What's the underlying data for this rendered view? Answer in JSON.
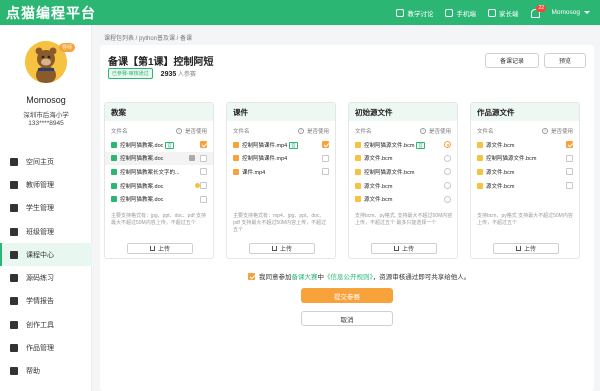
{
  "app": {
    "logo": "点猫编程平台"
  },
  "topnav": {
    "items": [
      {
        "label": "教学讨论",
        "icon": "discussion-icon"
      },
      {
        "label": "手机端",
        "icon": "mobile-icon"
      },
      {
        "label": "家长端",
        "icon": "parent-icon"
      }
    ],
    "notifications": "22",
    "username": "Momosog"
  },
  "profile": {
    "avatar_tag": "导师",
    "name": "Momosog",
    "school": "深圳市后海小学",
    "phone": "133****8945"
  },
  "sidebar": {
    "items": [
      {
        "label": "空间主页",
        "icon": "home-icon"
      },
      {
        "label": "教师管理",
        "icon": "teachers-icon"
      },
      {
        "label": "学生管理",
        "icon": "students-icon"
      },
      {
        "label": "班级管理",
        "icon": "class-icon"
      },
      {
        "label": "课程中心",
        "icon": "course-icon"
      },
      {
        "label": "源码练习",
        "icon": "code-icon"
      },
      {
        "label": "学情报告",
        "icon": "report-icon"
      },
      {
        "label": "创作工具",
        "icon": "tools-icon"
      },
      {
        "label": "作品管理",
        "icon": "works-icon"
      },
      {
        "label": "帮助",
        "icon": "help-icon"
      }
    ],
    "active_index": 4
  },
  "breadcrumb": "课程包列表 / python普及课 / 备课",
  "header": {
    "title": "备课【第1课】控制阿短",
    "status": "已参赛-审核通过",
    "count": "2935",
    "count_unit": "人参赛",
    "record_button": "备课记录",
    "preview_button": "预览"
  },
  "panels": [
    {
      "title": "教案",
      "col_name": "文件名",
      "col_use": "是否使用",
      "files": [
        {
          "name": "控制阿猫教案.doc",
          "icon_color": "#2bb673",
          "tag": "官",
          "check": true,
          "highlight": false,
          "trash": false,
          "dot": false
        },
        {
          "name": "控制阿猫教案.doc",
          "icon_color": "#2bb673",
          "tag": "",
          "check": false,
          "highlight": true,
          "trash": true,
          "dot": false
        },
        {
          "name": "控制阿猫教案长文字的...",
          "icon_color": "#2bb673",
          "tag": "",
          "check": false,
          "highlight": false,
          "trash": false,
          "dot": false
        },
        {
          "name": "控制阿猫教案.doc",
          "icon_color": "#2bb673",
          "tag": "",
          "check": false,
          "highlight": false,
          "trash": false,
          "dot": true
        },
        {
          "name": "控制阿猫教案.doc",
          "icon_color": "#2bb673",
          "tag": "",
          "check": false,
          "highlight": false,
          "trash": false,
          "dot": false
        }
      ],
      "hint": "主要支持格式有：jpg、ppt、doc、pdf 支持最大不超过50M内容上传，不超过五个",
      "upload": "上传"
    },
    {
      "title": "课件",
      "col_name": "文件名",
      "col_use": "是否使用",
      "files": [
        {
          "name": "控制阿猫课件.mp4",
          "icon_color": "#f7a23b",
          "tag": "官",
          "check": true
        },
        {
          "name": "控制阿猫课件.mp4",
          "icon_color": "#f7a23b",
          "tag": "",
          "check": false
        },
        {
          "name": "课件.mp4",
          "icon_color": "#f7a23b",
          "tag": "",
          "check": false
        }
      ],
      "hint": "主要支持格式有：mp4、jpg、ppt、doc、pdf 支持最大不超过50M内容上传，不超过五个",
      "upload": "上传"
    },
    {
      "title": "初始源文件",
      "col_name": "文件名",
      "col_use": "是否使用",
      "files": [
        {
          "name": "控制阿猫源文件.bcm",
          "icon_color": "#f5c242",
          "tag": "官",
          "check": true
        },
        {
          "name": "源文件.bcm",
          "icon_color": "#f5c242",
          "tag": "",
          "check": false
        },
        {
          "name": "控制阿猫源文件.bcm",
          "icon_color": "#f5c242",
          "tag": "",
          "check": false
        },
        {
          "name": "源文件.bcm",
          "icon_color": "#f5c242",
          "tag": "",
          "check": false
        },
        {
          "name": "源文件.bcm",
          "icon_color": "#f5c242",
          "tag": "",
          "check": false
        }
      ],
      "hint": "支持bcm、py格式, 支持最大不超过50M内容上传，不超过五个 最多只能选择一个",
      "upload": "上传"
    },
    {
      "title": "作品源文件",
      "col_name": "文件名",
      "col_use": "是否使用",
      "files": [
        {
          "name": "源文件.bcm",
          "icon_color": "#f5c242",
          "tag": "",
          "check": true
        },
        {
          "name": "控制阿猫源文件.bcm",
          "icon_color": "#f5c242",
          "tag": "",
          "check": false
        },
        {
          "name": "源文件.bcm",
          "icon_color": "#f5c242",
          "tag": "",
          "check": false
        },
        {
          "name": "源文件.bcm",
          "icon_color": "#f5c242",
          "tag": "",
          "check": false
        }
      ],
      "hint": "支持bcm、py格式 支持最大不超过50M内容上传，不超过五个",
      "upload": "上传"
    }
  ],
  "agreement": {
    "prefix": "我同意参加",
    "link1": "备课大赛",
    "mid": "中",
    "link2": "《信息公开规则》",
    "suffix": "，资源审核通过即可共享给他人。"
  },
  "submit_button": "提交参赛",
  "cancel_button": "取消",
  "colors": {
    "brand": "#2bb673",
    "accent": "#f7a23b"
  }
}
